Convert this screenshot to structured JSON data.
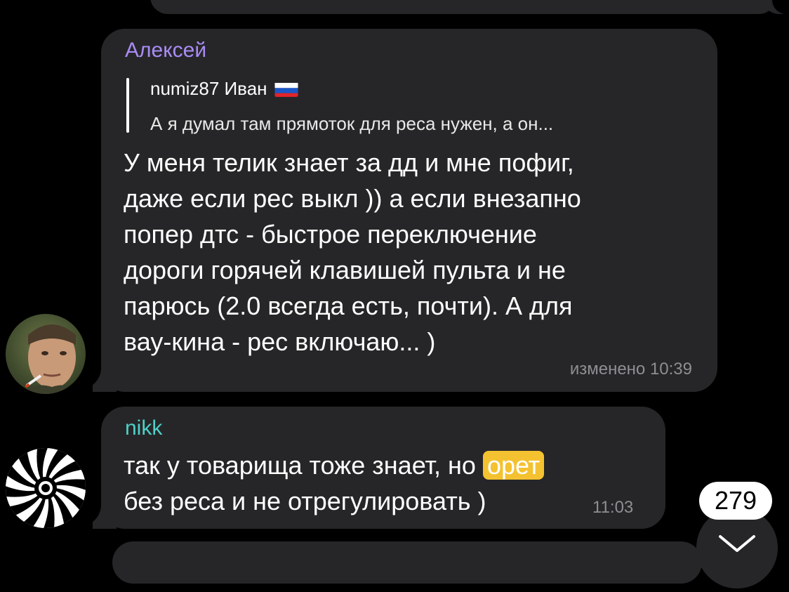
{
  "messages": [
    {
      "sender": "Алексей",
      "sender_color": "#a98cf5",
      "reply": {
        "author": "numiz87 Иван",
        "author_flag": "russia-flag",
        "text": "А я думал там прямоток для реса нужен, а он..."
      },
      "lines": [
        "У меня телик знает за дд и мне пофиг,",
        "даже если рес выкл )) а если внезапно",
        "попер дтс - быстрое переключение",
        "дороги горячей клавишей пульта и не",
        "парюсь (2.0 всегда есть, почти). А для",
        "вау-кина - рес включаю... )"
      ],
      "meta": "изменено 10:39"
    },
    {
      "sender": "nikk",
      "sender_color": "#4fd0c8",
      "line1_before": "так у товарища тоже знает, но ",
      "line1_highlight": "орет",
      "line2": "без реса и не отрегулировать )",
      "highlight_color": "#f4c230",
      "meta": "11:03"
    }
  ],
  "unread_count": "279",
  "scroll_icon": "chevron-down-icon"
}
